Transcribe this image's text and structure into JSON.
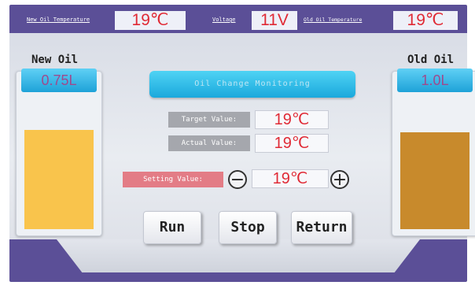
{
  "topbar": {
    "new_oil_temp_label": "New Oil Temperature",
    "new_oil_temp_value": "19℃",
    "voltage_label": "Voltage",
    "voltage_value": "11V",
    "old_oil_temp_label": "Old Oil Temperature",
    "old_oil_temp_value": "19℃"
  },
  "tanks": {
    "new": {
      "title": "New Oil",
      "volume": "0.75L",
      "fill_fraction": 0.76,
      "color": "#f9c44c"
    },
    "old": {
      "title": "Old Oil",
      "volume": "1.0L",
      "fill_fraction": 0.74,
      "color": "#c88a2c"
    }
  },
  "main": {
    "banner_title": "Oil Change Monitoring",
    "target_label": "Target Value:",
    "target_value": "19℃",
    "actual_label": "Actual Value:",
    "actual_value": "19℃",
    "setting_label": "Setting Value:",
    "setting_value": "19℃",
    "minus_symbol": "−",
    "plus_symbol": "+"
  },
  "buttons": {
    "run": "Run",
    "stop": "Stop",
    "return": "Return"
  },
  "colors": {
    "frame": "#5b4f97",
    "value_text": "#e02a35",
    "banner": "#1fb0e2"
  }
}
